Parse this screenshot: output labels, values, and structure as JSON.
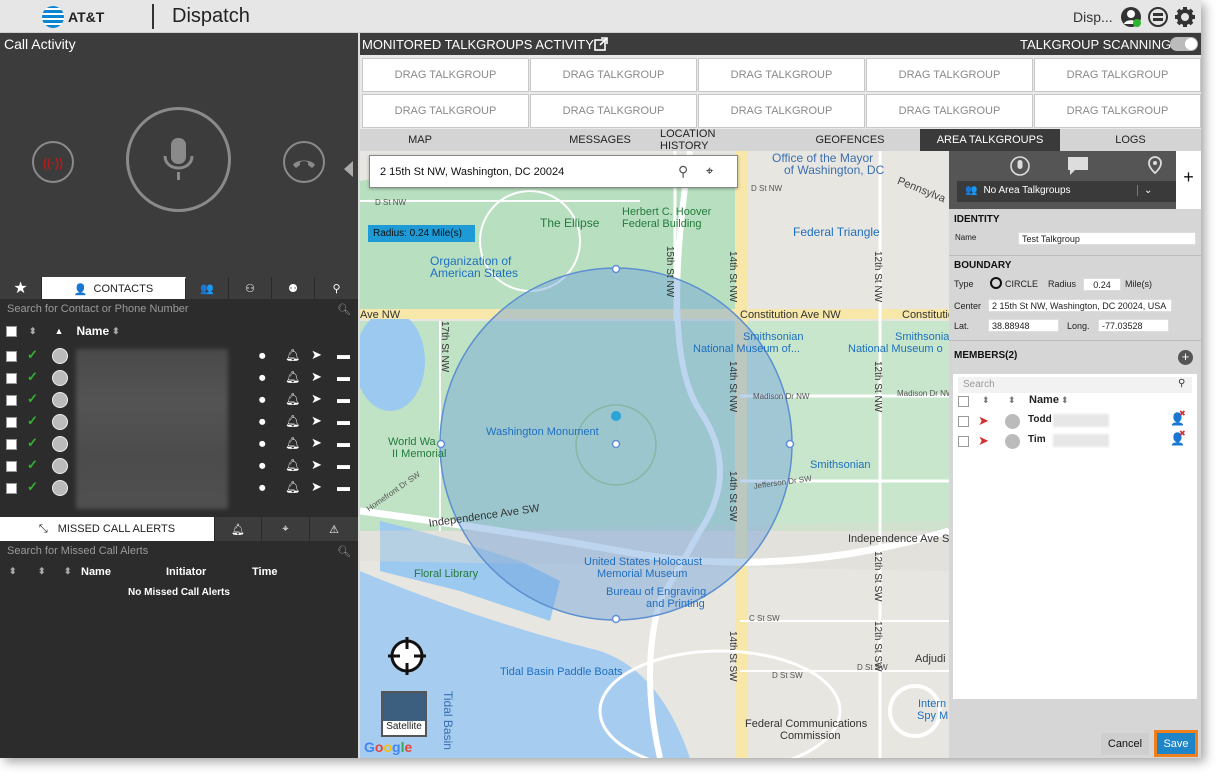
{
  "header": {
    "brand": "AT&T",
    "app_title": "Dispatch",
    "user_label": "Disp..."
  },
  "call_activity": {
    "title": "Call Activity"
  },
  "contacts": {
    "tab_label": "CONTACTS",
    "search_placeholder": "Search for Contact or Phone Number",
    "name_header": "Name",
    "row_count": 7
  },
  "missed": {
    "tab_label": "MISSED CALL ALERTS",
    "search_placeholder": "Search for Missed Call Alerts",
    "columns": [
      "Name",
      "Initiator",
      "Time"
    ],
    "empty_text": "No Missed Call Alerts"
  },
  "monitored": {
    "title": "MONITORED TALKGROUPS ACTIVITY",
    "scanning_label": "TALKGROUP SCANNING",
    "slot_label": "DRAG TALKGROUP",
    "slots": 10
  },
  "tabs": [
    "MAP",
    "MESSAGES",
    "LOCATION HISTORY",
    "GEOFENCES",
    "AREA TALKGROUPS",
    "LOGS"
  ],
  "active_tab": "AREA TALKGROUPS",
  "map": {
    "address": "2 15th St NW, Washington, DC 20024",
    "radius_text": "Radius: 0.24 Mile(s)",
    "satellite_label": "Satellite",
    "google_label": "Google",
    "labels": {
      "office_mayor": "Office of the Mayor",
      "of_washington": "of Washington, DC",
      "pennsylvania": "Pennsylva",
      "d_st_1": "D St NW",
      "d_st_2": "D St NW",
      "ellipse": "The Ellipse",
      "hoover1": "Herbert C. Hoover",
      "hoover2": "Federal Building",
      "fed_triangle": "Federal Triangle",
      "org_amer1": "Organization of",
      "org_amer2": "American States",
      "constitution1": "Constitution Ave NW",
      "constitution2": "Constitutio",
      "ave_nw": "Ave NW",
      "smithsonian1": "Smithsonian",
      "nmh1": "National Museum of...",
      "smithsonian2": "Smithsonian",
      "nmh2": "National Museum o",
      "madison1": "Madison Dr NW",
      "madison2": "Madison Dr NW",
      "wash_mon": "Washington Monument",
      "ww2_1": "World Wa",
      "ww2_2": "II Memorial",
      "smithsonian3": "Smithsonian",
      "jefferson": "Jefferson Dr SW",
      "homefront": "Homefront Dr SW",
      "independence1": "Independence Ave SW",
      "independence2": "Independence Ave SW",
      "holocaust1": "United States Holocaust",
      "holocaust2": "Memorial Museum",
      "floral": "Floral Library",
      "engraving1": "Bureau of Engraving",
      "engraving2": "and Printing",
      "c_st": "C St SW",
      "tidal_boats": "Tidal Basin Paddle Boats",
      "tidal_basin": "Tidal Basin",
      "fcc1": "Federal Communications",
      "fcc2": "Commission",
      "adjudi": "Adjudi",
      "intern1": "Intern",
      "intern2": "Spy M",
      "st17": "17th St NW",
      "st15": "15th St NW",
      "st14a": "14th St NW",
      "st14b": "14th St NW",
      "st14c": "14th St SW",
      "st14d": "14th St SW",
      "st12a": "12th St NW",
      "st12b": "12th St NW",
      "st12c": "12th St SW",
      "st12d": "12th St SW",
      "d_st_3": "D St SW",
      "d_st_4": "D St SW"
    }
  },
  "area": {
    "no_talkgroups": "No Area Talkgroups",
    "identity_label": "IDENTITY",
    "name_label": "Name",
    "name_value": "Test Talkgroup",
    "boundary_label": "BOUNDARY",
    "type_label": "Type",
    "type_value": "CIRCLE",
    "radius_label": "Radius",
    "radius_value": "0.24",
    "radius_unit": "Mile(s)",
    "center_label": "Center",
    "center_value": "2 15th St NW, Washington, DC 20024, USA",
    "lat_label": "Lat.",
    "lat_value": "38.88948",
    "long_label": "Long.",
    "long_value": "-77.03528",
    "members_label": "MEMBERS(2)",
    "members_search": "Search",
    "members_name_header": "Name",
    "members": [
      {
        "name": "Todd"
      },
      {
        "name": "Tim"
      }
    ],
    "cancel_label": "Cancel",
    "save_label": "Save"
  },
  "colors": {
    "accent": "#1e9ad6",
    "save_highlight": "#f07f1c",
    "check": "#2fb52f",
    "dark": "#3c3c3c"
  }
}
